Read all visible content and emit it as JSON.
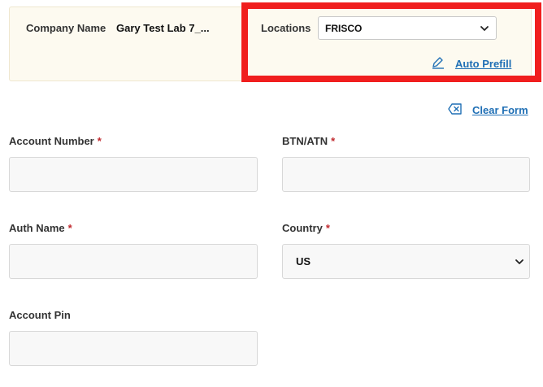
{
  "company": {
    "label": "Company Name",
    "value": "Gary Test Lab 7_..."
  },
  "locations": {
    "label": "Locations",
    "selected": "FRISCO"
  },
  "links": {
    "auto_prefill": "Auto Prefill",
    "clear_form": "Clear Form"
  },
  "fields": {
    "account_number": {
      "label": "Account Number",
      "required": "*",
      "value": ""
    },
    "btn_atn": {
      "label": "BTN/ATN",
      "required": "*",
      "value": ""
    },
    "auth_name": {
      "label": "Auth Name",
      "required": "*",
      "value": ""
    },
    "country": {
      "label": "Country",
      "required": "*",
      "selected": "US"
    },
    "account_pin": {
      "label": "Account Pin",
      "value": ""
    }
  },
  "colors": {
    "accent_link": "#1f6fb5",
    "highlight_border": "#f01e1e",
    "required": "#c0282d",
    "info_bg": "#fdfaf0"
  },
  "icons": {
    "prefill": "pencil-icon",
    "clear": "clear-icon",
    "select": "chevron-down-icon"
  }
}
